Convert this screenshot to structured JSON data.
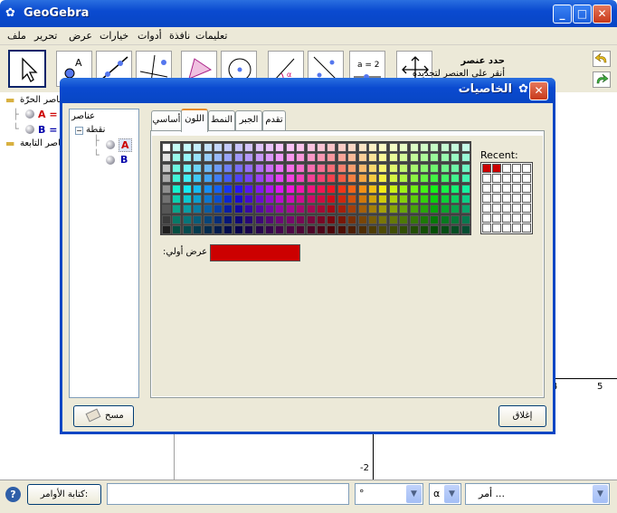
{
  "app": {
    "title": "GeoGebra"
  },
  "menu": [
    "ملف",
    "تحرير",
    "عرض",
    "خيارات",
    "أدوات",
    "نافذة",
    "تعليمات"
  ],
  "toolbar": {
    "help_title": "حدد عنصر",
    "help_sub": "أنقر على العنصر لتحديده",
    "tool_label_a2": "a = 2"
  },
  "algebra": {
    "free_folder": "عناصر الحرّة",
    "item_a": "A = (",
    "item_b": "B = (",
    "dependent_folder": "عناصر التابعة"
  },
  "graphics": {
    "x_tick_4": "4",
    "x_tick_5": "5",
    "y_tick_m2": "-2"
  },
  "bottom": {
    "input_bar_button": "كتابة الأوامر:",
    "degree_value": "°",
    "alpha_value": "α",
    "command_value": "أمر ..."
  },
  "dialog": {
    "title": "الخاصيات",
    "tree_root": "عناصر",
    "tree_group": "نقطة",
    "tree_a": "A",
    "tree_b": "B",
    "tabs": [
      "أساسي",
      "اللون",
      "النمط",
      "الجبر",
      "تقدم"
    ],
    "active_tab": 1,
    "recent_label": "Recent:",
    "preview_label": "عرض أولي:",
    "preview_color": "#cc0000",
    "delete_button": "مسح",
    "close_button": "إغلاق"
  },
  "colors": {
    "xp_blue": "#0846c4",
    "point_a": "#cc0000",
    "point_b": "#0000aa"
  }
}
